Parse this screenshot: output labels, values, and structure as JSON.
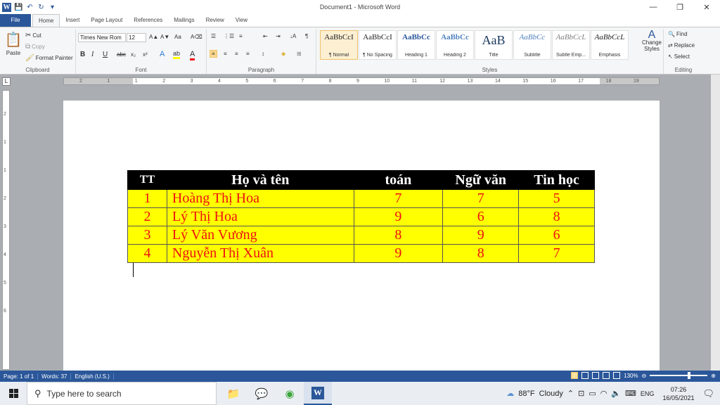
{
  "window": {
    "title": "Document1 - Microsoft Word",
    "min": "—",
    "max": "❐",
    "close": "✕"
  },
  "qat": {
    "word_logo": "W",
    "save": "💾",
    "undo": "↶",
    "redo": "↻",
    "more": "▾"
  },
  "tabs": [
    "File",
    "Home",
    "Insert",
    "Page Layout",
    "References",
    "Mailings",
    "Review",
    "View"
  ],
  "ribbon": {
    "clipboard": {
      "label": "Clipboard",
      "paste": "Paste",
      "cut": "Cut",
      "copy": "Copy",
      "format_painter": "Format Painter"
    },
    "font": {
      "label": "Font",
      "name": "Times New Rom",
      "size": "12",
      "bold": "B",
      "italic": "I",
      "underline": "U",
      "strike": "abc",
      "sub": "x₂",
      "sup": "x²",
      "grow": "A▲",
      "shrink": "A▼",
      "case": "Aa",
      "clear": "A⌫",
      "effects": "A",
      "highlight": "ab",
      "color": "A"
    },
    "paragraph": {
      "label": "Paragraph",
      "bullets": "☰",
      "numbering": "⋮☰",
      "multilevel": "≡",
      "dec_indent": "⇤",
      "inc_indent": "⇥",
      "sort": "↓A",
      "show": "¶",
      "align_left": "≡",
      "center": "≡",
      "right": "≡",
      "justify": "≡",
      "spacing": "↕",
      "shading": "◈",
      "borders": "⊞"
    },
    "styles": {
      "label": "Styles",
      "items": [
        {
          "preview": "AaBbCcI",
          "name": "¶ Normal"
        },
        {
          "preview": "AaBbCcI",
          "name": "¶ No Spacing"
        },
        {
          "preview": "AaBbCc",
          "name": "Heading 1"
        },
        {
          "preview": "AaBbCc",
          "name": "Heading 2"
        },
        {
          "preview": "AaB",
          "name": "Title"
        },
        {
          "preview": "AaBbCc",
          "name": "Subtitle"
        },
        {
          "preview": "AaBbCcL",
          "name": "Subtle Emp..."
        },
        {
          "preview": "AaBbCcL",
          "name": "Emphasis"
        }
      ],
      "change": "Change Styles"
    },
    "editing": {
      "label": "Editing",
      "find": "Find",
      "replace": "Replace",
      "select": "Select"
    }
  },
  "ruler": {
    "h_ticks": [
      "2",
      "1",
      "1",
      "2",
      "3",
      "4",
      "5",
      "6",
      "7",
      "8",
      "9",
      "10",
      "11",
      "12",
      "13",
      "14",
      "15",
      "16",
      "17",
      "18",
      "19"
    ],
    "v_ticks": [
      "2",
      "1",
      "1",
      "2",
      "3",
      "4",
      "5",
      "6"
    ]
  },
  "document": {
    "headers": [
      "TT",
      "Họ và tên",
      "toán",
      "Ngữ văn",
      "Tin học"
    ],
    "rows": [
      [
        "1",
        "Hoàng Thị Hoa",
        "7",
        "7",
        "5"
      ],
      [
        "2",
        "Lý  Thị Hoa",
        "9",
        "6",
        "8"
      ],
      [
        "3",
        "Lý  Văn Vương",
        "8",
        "9",
        "6"
      ],
      [
        "4",
        "Nguyễn Thị Xuân",
        "9",
        "8",
        "7"
      ]
    ]
  },
  "status": {
    "page": "Page: 1 of 1",
    "words": "Words: 37",
    "language": "English (U.S.)",
    "zoom": "130%",
    "zoom_level": 1.3
  },
  "taskbar": {
    "search_placeholder": "Type here to search",
    "weather_temp": "88°F",
    "weather_text": "Cloudy",
    "lang": "ENG",
    "time": "07:26",
    "date": "16/05/2021"
  }
}
